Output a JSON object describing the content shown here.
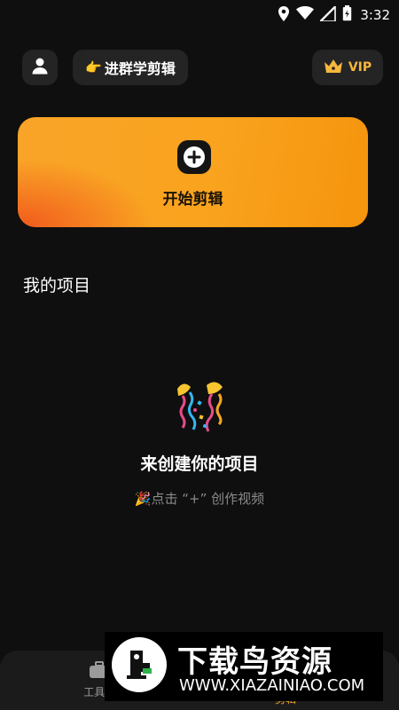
{
  "status_bar": {
    "time": "3:32",
    "icons": [
      "location-icon",
      "wifi-icon",
      "signal-icon",
      "battery-icon"
    ]
  },
  "header": {
    "avatar_icon": "user-icon",
    "group_button": {
      "emoji": "👉",
      "label": "进群学剪辑"
    },
    "vip_button": {
      "icon": "crown-icon",
      "label": "VIP"
    }
  },
  "start_card": {
    "icon": "plus-icon",
    "label": "开始剪辑"
  },
  "projects": {
    "title": "我的项目",
    "empty": {
      "illustration": "party-popper-icon",
      "title": "来创建你的项目",
      "hint_emoji": "🎉",
      "hint": "点击 “+” 创作视频"
    }
  },
  "tab_bar": {
    "tools_label": "工具...",
    "edit_label": "剪辑"
  },
  "watermark": {
    "title": "下载鸟资源",
    "url": "WWW.XIAZAINIAO.COM"
  },
  "colors": {
    "background": "#0f0f0f",
    "accent": "#f9a428",
    "vip": "#f6b73c"
  }
}
